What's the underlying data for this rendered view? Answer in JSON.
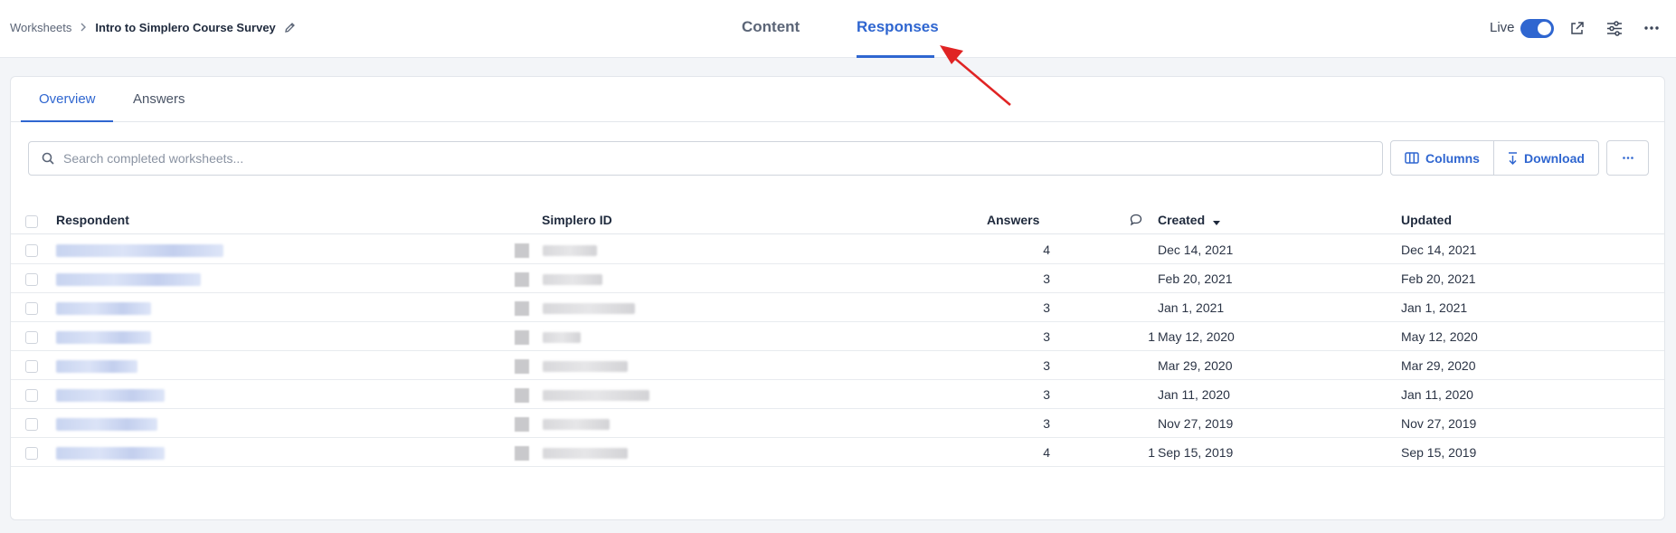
{
  "breadcrumb": {
    "root": "Worksheets",
    "current": "Intro to Simplero Course Survey"
  },
  "main_tabs": [
    {
      "label": "Content"
    },
    {
      "label": "Responses"
    }
  ],
  "header": {
    "live_label": "Live",
    "live_on": true
  },
  "sub_tabs": [
    {
      "label": "Overview"
    },
    {
      "label": "Answers"
    }
  ],
  "search": {
    "placeholder": "Search completed worksheets...",
    "value": ""
  },
  "toolbar": {
    "columns_label": "Columns",
    "download_label": "Download",
    "more_label": "···"
  },
  "table": {
    "headers": {
      "respondent": "Respondent",
      "simplero_id": "Simplero ID",
      "answers": "Answers",
      "created": "Created",
      "updated": "Updated"
    },
    "rows": [
      {
        "answers": "4",
        "comments": "",
        "created": "Dec 14, 2021",
        "updated": "Dec 14, 2021"
      },
      {
        "answers": "3",
        "comments": "",
        "created": "Feb 20, 2021",
        "updated": "Feb 20, 2021"
      },
      {
        "answers": "3",
        "comments": "",
        "created": "Jan 1, 2021",
        "updated": "Jan 1, 2021"
      },
      {
        "answers": "3",
        "comments": "1",
        "created": "May 12, 2020",
        "updated": "May 12, 2020"
      },
      {
        "answers": "3",
        "comments": "",
        "created": "Mar 29, 2020",
        "updated": "Mar 29, 2020"
      },
      {
        "answers": "3",
        "comments": "",
        "created": "Jan 11, 2020",
        "updated": "Jan 11, 2020"
      },
      {
        "answers": "3",
        "comments": "",
        "created": "Nov 27, 2019",
        "updated": "Nov 27, 2019"
      },
      {
        "answers": "4",
        "comments": "1",
        "created": "Sep 15, 2019",
        "updated": "Sep 15, 2019"
      }
    ]
  },
  "colors": {
    "accent": "#2f66d0",
    "annotation": "#e02424",
    "border": "#cfd4dc"
  },
  "icons": [
    "pencil-icon",
    "external-link-icon",
    "sliders-icon",
    "more-horizontal-icon",
    "search-icon",
    "columns-icon",
    "download-icon",
    "comment-icon",
    "sort-down-icon",
    "chevron-right-icon"
  ]
}
